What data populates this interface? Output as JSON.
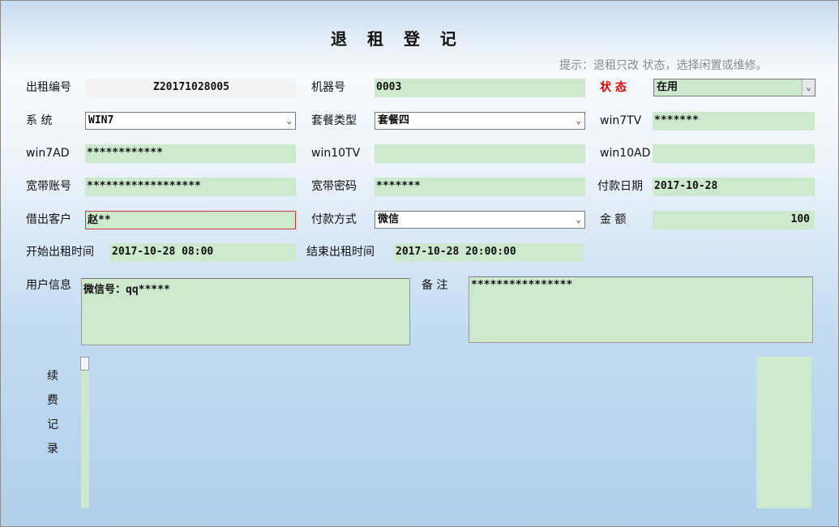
{
  "title": "退 租 登 记",
  "tip": "提示：退租只改 状态，选择闲置或维修。",
  "fields": {
    "rent_no": {
      "label": "出租编号",
      "value": "Z20171028005"
    },
    "machine_no": {
      "label": "机器号",
      "value": "0003"
    },
    "status": {
      "label": "状 态",
      "value": "在用"
    },
    "system": {
      "label": "系 统",
      "value": "WIN7"
    },
    "package_type": {
      "label": "套餐类型",
      "value": "套餐四"
    },
    "win7tv": {
      "label": "win7TV",
      "value": "*******"
    },
    "win7ad": {
      "label": "win7AD",
      "value": "************"
    },
    "win10tv": {
      "label": "win10TV",
      "value": ""
    },
    "win10ad": {
      "label": "win10AD",
      "value": ""
    },
    "broadband_account": {
      "label": "宽带账号",
      "value": "******************"
    },
    "broadband_password": {
      "label": "宽带密码",
      "value": "*******"
    },
    "payment_date": {
      "label": "付款日期",
      "value": "2017-10-28"
    },
    "customer": {
      "label": "借出客户",
      "value": "赵**"
    },
    "payment_method": {
      "label": "付款方式",
      "value": "微信"
    },
    "amount": {
      "label": "金 额",
      "value": "100"
    },
    "start_time": {
      "label": "开始出租时间",
      "value": "2017-10-28 08:00"
    },
    "end_time": {
      "label": "结束出租时间",
      "value": "2017-10-28 20:00:00"
    },
    "user_info": {
      "label": "用户信息",
      "value": "微信号：qq*****"
    },
    "remarks": {
      "label": "备 注",
      "value": "****************"
    }
  },
  "renewal": {
    "label_chars": [
      "续",
      "费",
      "记",
      "录"
    ]
  }
}
